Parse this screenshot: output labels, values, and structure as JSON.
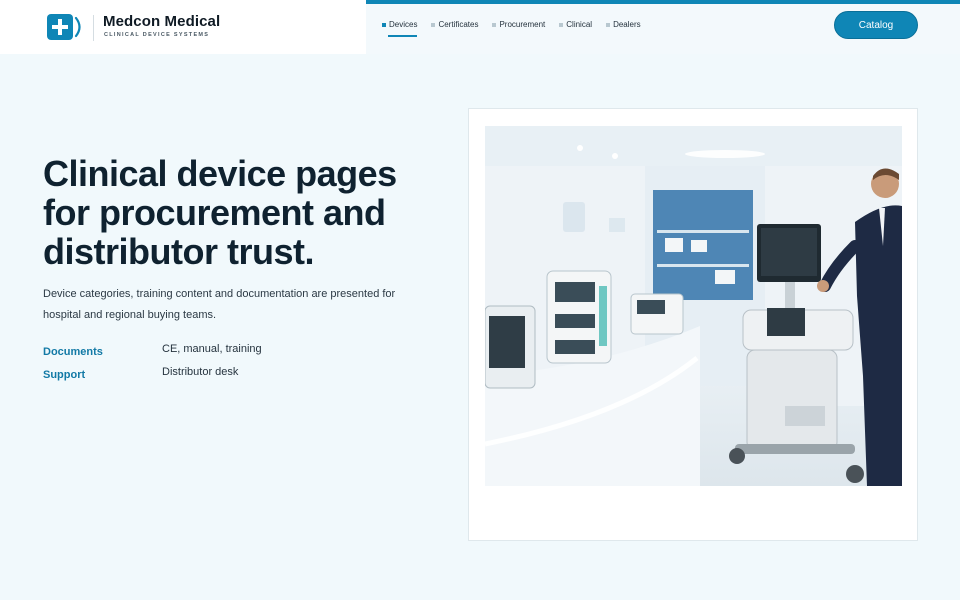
{
  "brand": {
    "name": "Medcon Medical",
    "tagline": "CLINICAL DEVICE SYSTEMS",
    "accent": "#0f86b6"
  },
  "nav": {
    "items": [
      {
        "label": "Devices",
        "active": true
      },
      {
        "label": "Certificates",
        "active": false
      },
      {
        "label": "Procurement",
        "active": false
      },
      {
        "label": "Clinical",
        "active": false
      },
      {
        "label": "Dealers",
        "active": false
      }
    ],
    "catalog_label": "Catalog"
  },
  "hero": {
    "title": "Clinical device pages for procurement and distributor trust.",
    "description": "Device categories, training content and documentation are presented for hospital and regional buying teams.",
    "facts": [
      {
        "label": "Documents",
        "value": "CE, manual, training"
      },
      {
        "label": "Support",
        "value": "Distributor desk"
      }
    ]
  },
  "media": {
    "icon": "medical-showroom-photo"
  }
}
